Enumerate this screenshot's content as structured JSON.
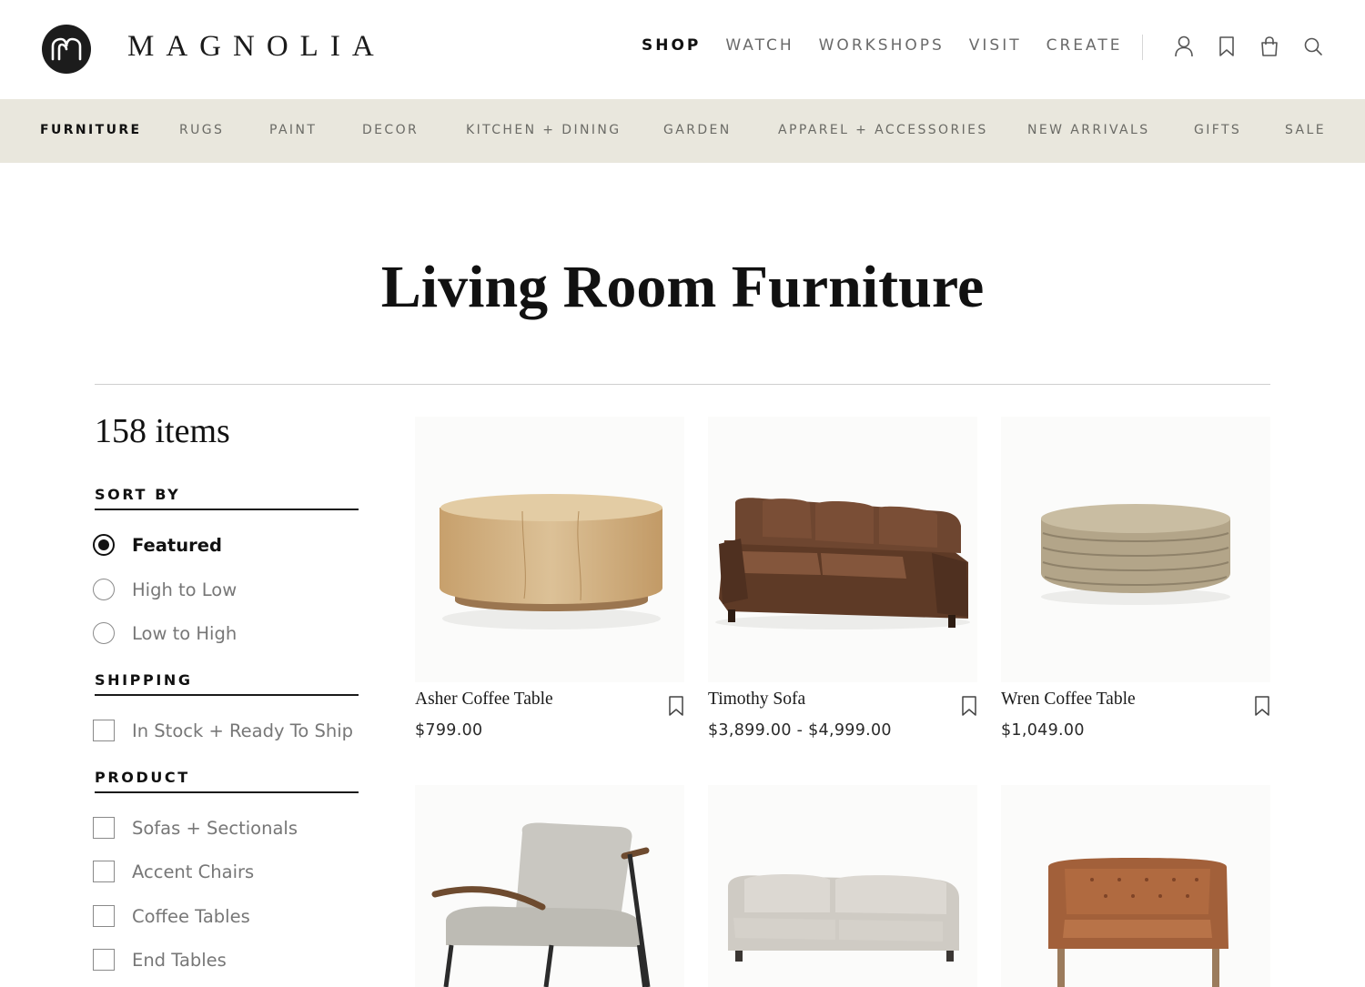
{
  "brand": {
    "name": "MAGNOLIA"
  },
  "main_nav": [
    {
      "label": "SHOP",
      "active": true
    },
    {
      "label": "WATCH",
      "active": false
    },
    {
      "label": "WORKSHOPS",
      "active": false
    },
    {
      "label": "VISIT",
      "active": false
    },
    {
      "label": "CREATE",
      "active": false
    }
  ],
  "header_icons": [
    "account-icon",
    "bookmark-icon",
    "bag-icon",
    "search-icon"
  ],
  "categories": [
    {
      "label": "FURNITURE",
      "active": true
    },
    {
      "label": "RUGS"
    },
    {
      "label": "PAINT"
    },
    {
      "label": "DECOR"
    },
    {
      "label": "KITCHEN + DINING"
    },
    {
      "label": "GARDEN"
    },
    {
      "label": "APPAREL + ACCESSORIES"
    },
    {
      "label": "NEW ARRIVALS"
    },
    {
      "label": "GIFTS"
    },
    {
      "label": "SALE"
    }
  ],
  "page": {
    "title": "Living Room Furniture",
    "item_count": "158 items"
  },
  "filters": {
    "sort": {
      "heading": "SORT BY",
      "options": [
        {
          "label": "Featured",
          "selected": true
        },
        {
          "label": "High to Low",
          "selected": false
        },
        {
          "label": "Low to High",
          "selected": false
        }
      ]
    },
    "shipping": {
      "heading": "SHIPPING",
      "options": [
        {
          "label": "In Stock + Ready To Ship",
          "checked": false
        }
      ]
    },
    "product": {
      "heading": "PRODUCT",
      "options": [
        {
          "label": "Sofas + Sectionals",
          "checked": false
        },
        {
          "label": "Accent Chairs",
          "checked": false
        },
        {
          "label": "Coffee Tables",
          "checked": false
        },
        {
          "label": "End Tables",
          "checked": false
        }
      ]
    }
  },
  "products": [
    {
      "name": "Asher Coffee Table",
      "price": "$799.00"
    },
    {
      "name": "Timothy Sofa",
      "price": "$3,899.00 - $4,999.00"
    },
    {
      "name": "Wren Coffee Table",
      "price": "$1,049.00"
    }
  ],
  "colors": {
    "category_bar": "#e9e7dd",
    "text_primary": "#111111",
    "text_muted": "#6b6b66"
  }
}
